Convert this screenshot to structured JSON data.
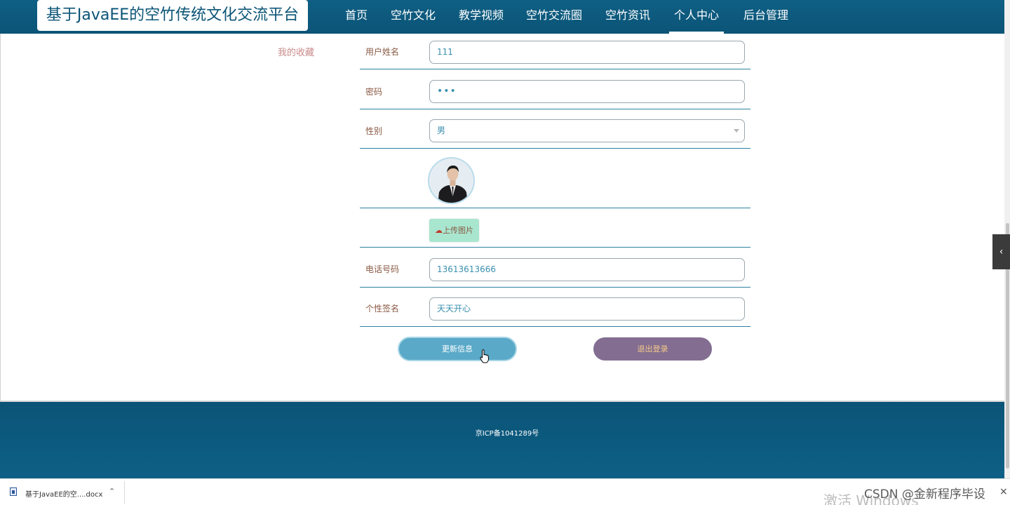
{
  "header": {
    "site_title": "基于JavaEE的空竹传统文化交流平台",
    "nav": [
      "首页",
      "空竹文化",
      "教学视频",
      "空竹交流圈",
      "空竹资讯",
      "个人中心",
      "后台管理"
    ],
    "active_nav": "个人中心"
  },
  "sidebar": {
    "favorites_label": "我的收藏"
  },
  "form": {
    "username_label": "用户姓名",
    "username_value": "111",
    "password_label": "密码",
    "password_value": "•••",
    "gender_label": "性别",
    "gender_value": "男",
    "upload_label": "上传图片",
    "phone_label": "电话号码",
    "phone_value": "13613613666",
    "signature_label": "个性签名",
    "signature_value": "天天开心",
    "update_button": "更新信息",
    "logout_button": "退出登录"
  },
  "footer": {
    "icp": "京ICP备1041289号"
  },
  "download_bar": {
    "file_name": "基于JavaEE的空....docx"
  },
  "watermark": {
    "activate_text": "激活 Windows",
    "csdn_text": "CSDN @金新程序毕设"
  },
  "icons": {
    "side_toggle": "chevron-left-icon",
    "upload": "cloud-upload-icon",
    "download_expand": "chevron-up-icon",
    "download_close": "close-icon",
    "file": "word-document-icon"
  },
  "colors": {
    "header_bg": "#0b5477",
    "update_button": "#5aa9c8",
    "logout_button": "#836e91",
    "upload_button": "#a9e6cf",
    "row_divider": "#2d82a0"
  }
}
